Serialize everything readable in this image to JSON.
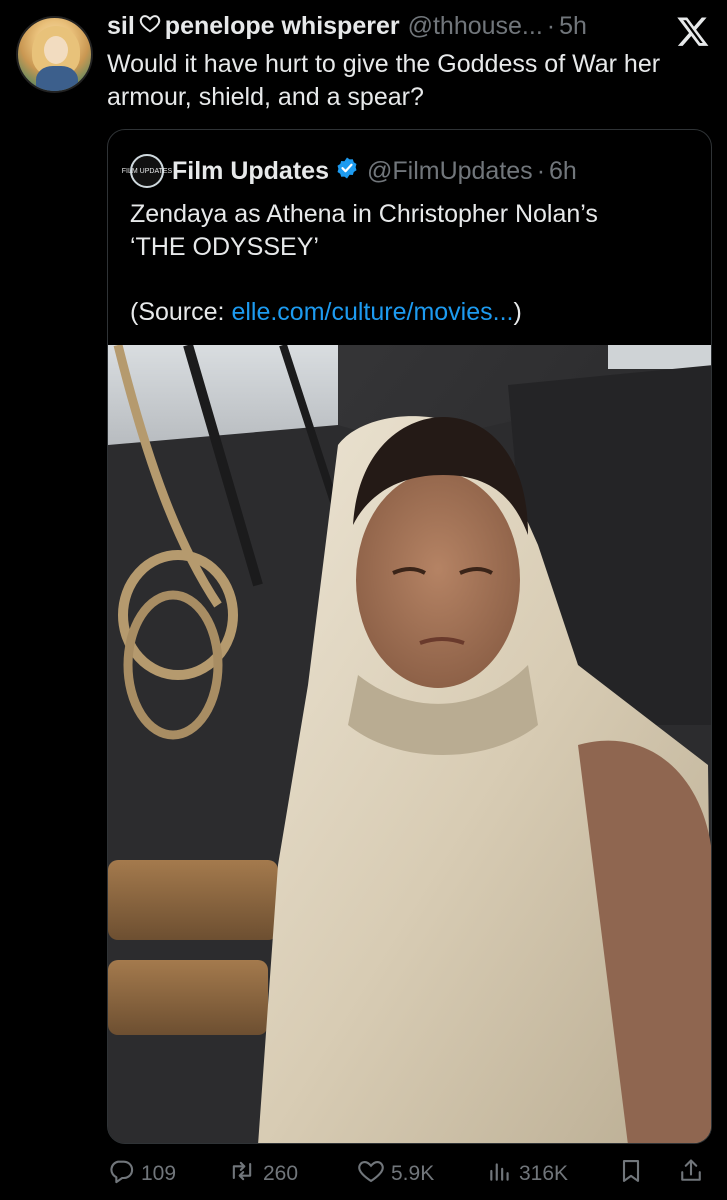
{
  "tweet": {
    "display_name": "sil",
    "display_name_rest": "penelope whisperer",
    "handle": "@thhouse...",
    "separator": "·",
    "time": "5h",
    "text": "Would it have hurt to give the Goddess of War her armour, shield, and a spear?"
  },
  "quote": {
    "avatar_text": "FILM UPDATES",
    "name": "Film Updates",
    "handle": "@FilmUpdates",
    "separator": "·",
    "time": "6h",
    "text_line1": "Zendaya as Athena in Christopher Nolan’s",
    "text_line2": "‘THE ODYSSEY’",
    "source_prefix": "(Source: ",
    "source_link": "elle.com/culture/movies...",
    "source_suffix": ")"
  },
  "actions": {
    "replies": "109",
    "reposts": "260",
    "likes": "5.9K",
    "views": "316K"
  },
  "colors": {
    "background": "#000000",
    "text": "#e7e9ea",
    "muted": "#71767b",
    "link": "#1d9bf0",
    "border": "#2f3336"
  },
  "icons": [
    "x-logo-icon",
    "heart-outline-icon",
    "verified-badge-icon",
    "reply-icon",
    "repost-icon",
    "like-icon",
    "views-icon",
    "bookmark-icon",
    "share-icon"
  ]
}
